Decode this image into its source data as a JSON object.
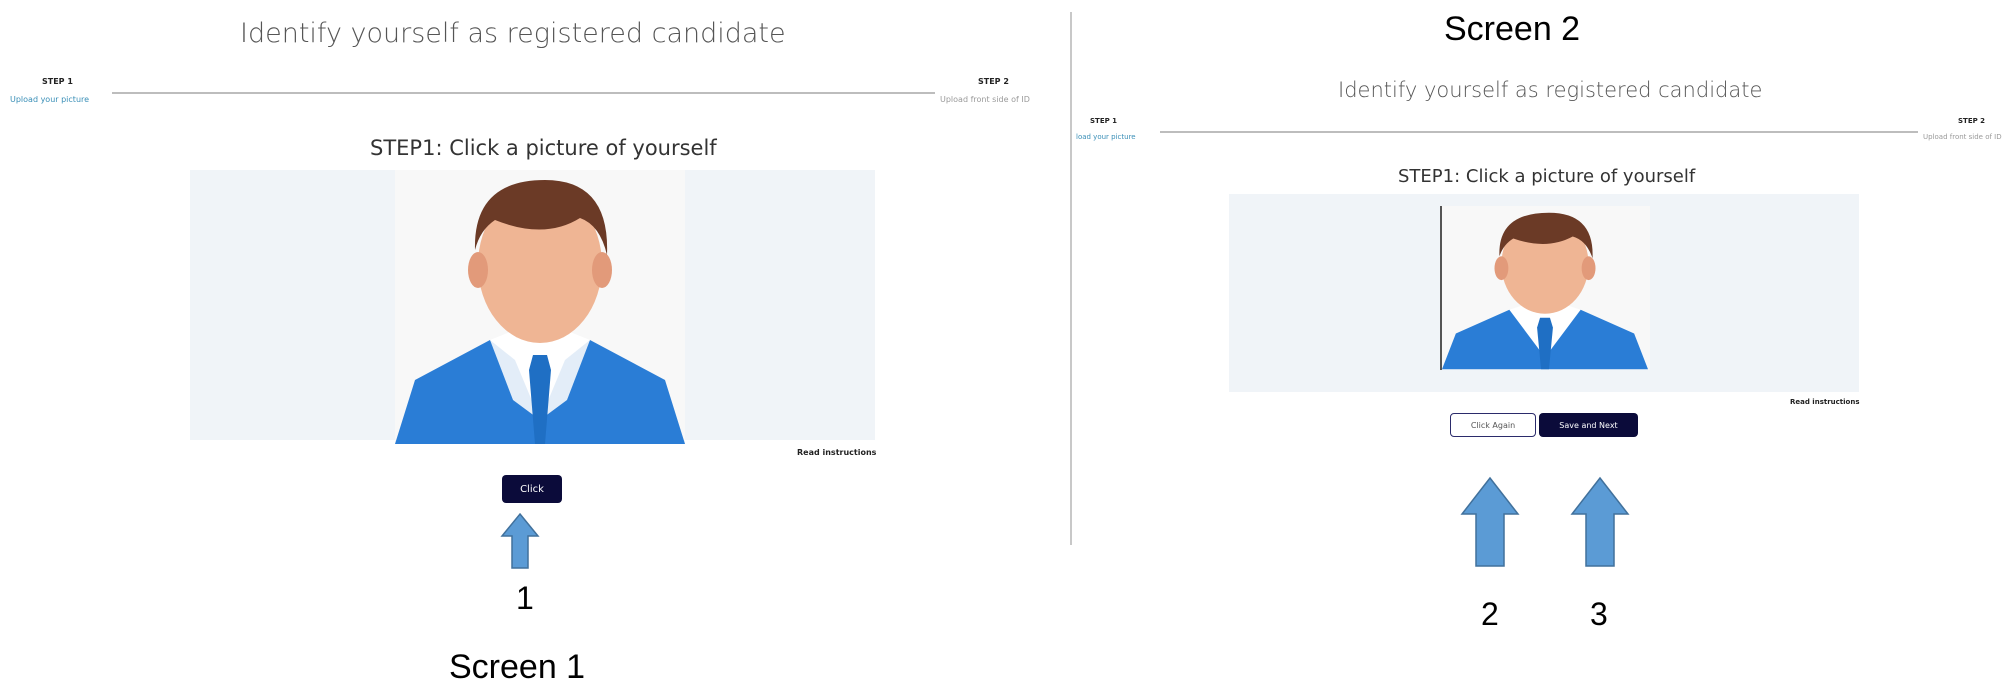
{
  "screen1": {
    "label": "Screen 1",
    "title": "Identify yourself as registered candidate",
    "step1_label": "STEP 1",
    "step1_sub": "Upload your picture",
    "step2_label": "STEP 2",
    "step2_sub": "Upload front side of ID",
    "heading": "STEP1: Click a picture of yourself",
    "read_instructions": "Read instructions",
    "click_button": "Click",
    "callout": "1"
  },
  "screen2": {
    "label": "Screen 2",
    "title": "Identify yourself as registered candidate",
    "step1_label": "STEP 1",
    "step1_sub": "load your picture",
    "step2_label": "STEP 2",
    "step2_sub": "Upload front side of ID",
    "heading": "STEP1: Click a picture of yourself",
    "read_instructions": "Read instructions",
    "click_again_button": "Click Again",
    "save_next_button": "Save and Next",
    "callout_click_again": "2",
    "callout_save_next": "3"
  },
  "colors": {
    "button_dark": "#0b0b3a",
    "accent_blue": "#3a8fb7",
    "arrow_blue": "#5b9bd5",
    "photo_bg": "#f0f4f8"
  }
}
